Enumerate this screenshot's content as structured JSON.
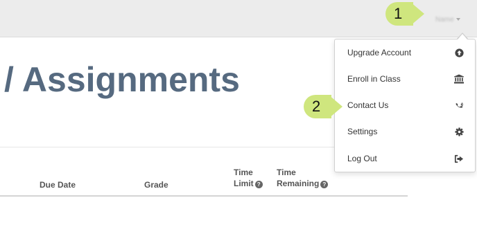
{
  "topbar": {
    "user_name": "Name"
  },
  "callouts": [
    "1",
    "2"
  ],
  "page": {
    "heading": "/ Assignments"
  },
  "table": {
    "columns": {
      "due_date": "Due Date",
      "grade": "Grade",
      "time_limit_line1": "Time",
      "time_limit_line2": "Limit",
      "time_remaining_line1": "Time",
      "time_remaining_line2": "Remaining"
    },
    "help_glyph": "?"
  },
  "menu": {
    "items": [
      {
        "label": "Upgrade Account",
        "icon": "upload-circle-icon"
      },
      {
        "label": "Enroll in Class",
        "icon": "institution-icon"
      },
      {
        "label": "Contact Us",
        "icon": "phone-volume-icon"
      },
      {
        "label": "Settings",
        "icon": "gear-icon"
      },
      {
        "label": "Log Out",
        "icon": "sign-out-icon"
      }
    ]
  },
  "colors": {
    "heading": "#566a80",
    "callout": "#cfe67e",
    "topbar": "#ececec",
    "icon": "#444444"
  }
}
